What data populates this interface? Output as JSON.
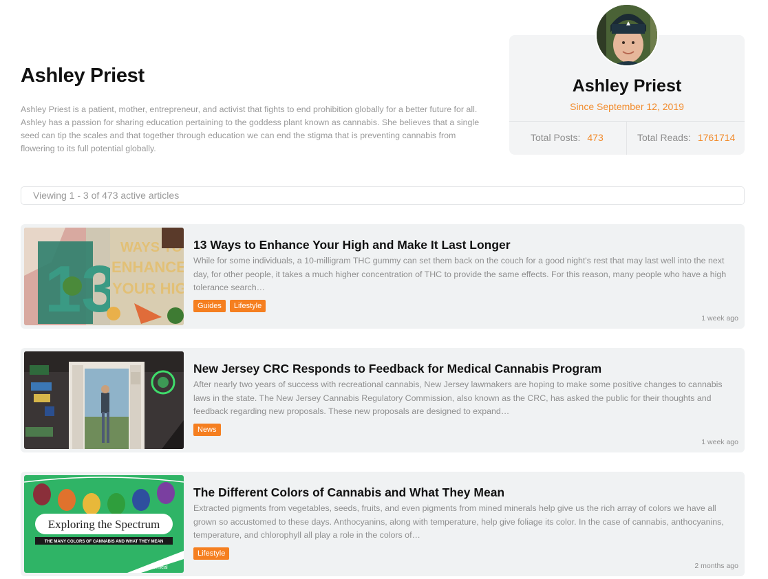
{
  "author": {
    "name": "Ashley Priest",
    "bio": "Ashley Priest is a patient, mother, entrepreneur, and activist that fights to end prohibition globally for a better future for all. Ashley has a passion for sharing education pertaining to the goddess plant known as cannabis. She believes that a single seed can tip the scales and that together through education we can end the stigma that is preventing cannabis from flowering to its full potential globally."
  },
  "profile": {
    "name": "Ashley Priest",
    "since": "Since September 12, 2019",
    "posts_label": "Total Posts:",
    "posts_value": "473",
    "reads_label": "Total Reads:",
    "reads_value": "1761714"
  },
  "viewing": "Viewing 1 - 3 of 473 active articles",
  "articles": [
    {
      "title": "13 Ways to Enhance Your High and Make It Last Longer",
      "excerpt": "While for some individuals, a 10-milligram THC gummy can set them back on the couch for a good night's rest that may last well into the next day, for other people, it takes a much higher concentration of THC to provide the same effects. For this reason, many people who have a high tolerance search…",
      "tags": [
        "Guides",
        "Lifestyle"
      ],
      "time": "1 week ago",
      "thumb_text": [
        "13",
        "WAYS TO",
        "ENHANCE",
        "YOUR HIGH"
      ]
    },
    {
      "title": "New Jersey CRC Responds to Feedback for Medical Cannabis Program",
      "excerpt": "After nearly two years of success with recreational cannabis, New Jersey lawmakers are hoping to make some positive changes to cannabis laws in the state. The New Jersey Cannabis Regulatory Commission, also known as the CRC, has asked the public for their thoughts and feedback regarding new proposals. These new proposals are designed to expand…",
      "tags": [
        "News"
      ],
      "time": "1 week ago"
    },
    {
      "title": "The Different Colors of Cannabis and What They Mean",
      "excerpt": "Extracted pigments from vegetables, seeds, fruits, and even pigments from mined minerals help give us the rich array of colors we have all grown so accustomed to these days. Anthocyanins, along with temperature, help give foliage its color. In the case of cannabis, anthocyanins, temperature, and chlorophyll all play a role in the colors of…",
      "tags": [
        "Lifestyle"
      ],
      "time": "2 months ago",
      "thumb_text": [
        "Exploring the Spectrum",
        "THE MANY COLORS OF CANNABIS AND WHAT THEY MEAN",
        "veriheal"
      ]
    }
  ],
  "colors": {
    "accent": "#f28b2c",
    "tag_bg": "#f57f20",
    "card_bg": "#f0f2f3"
  }
}
